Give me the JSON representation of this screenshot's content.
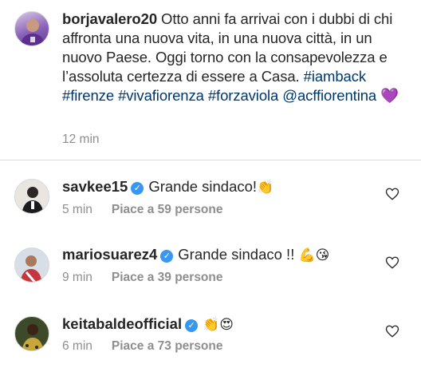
{
  "post": {
    "username": "borjavalero20",
    "text": " Otto anni fa arrivai con i dubbi di chi affronta una nuova vita, in una nuova città, in un nuovo Paese. Oggi torno con la consapevolezza e l’assoluta certezza di essere a Casa. ",
    "tags": [
      "#iamback",
      "#firenze",
      "#vivafiorenza",
      "#forzaviola",
      "@acffiorentina"
    ],
    "emoji": "💜",
    "time": "12 min"
  },
  "comments": [
    {
      "username": "savkee15",
      "text": "Grande sindaco!",
      "emoji": "👏",
      "time": "5 min",
      "likes": "Piace a 59 persone",
      "verified": true
    },
    {
      "username": "mariosuarez4",
      "text": "Grande sindaco !!",
      "emoji": "💪😘",
      "time": "9 min",
      "likes": "Piace a 39 persone",
      "verified": true
    },
    {
      "username": "keitabaldeofficial",
      "text": "",
      "emoji": "👏😍",
      "time": "6 min",
      "likes": "Piace a 73 persone",
      "verified": true
    }
  ],
  "icons": {
    "verified": "verified-check-icon",
    "like": "heart-outline-icon"
  },
  "colors": {
    "link": "#00376b",
    "verified": "#3897f0",
    "meta": "#8e8e8e"
  }
}
